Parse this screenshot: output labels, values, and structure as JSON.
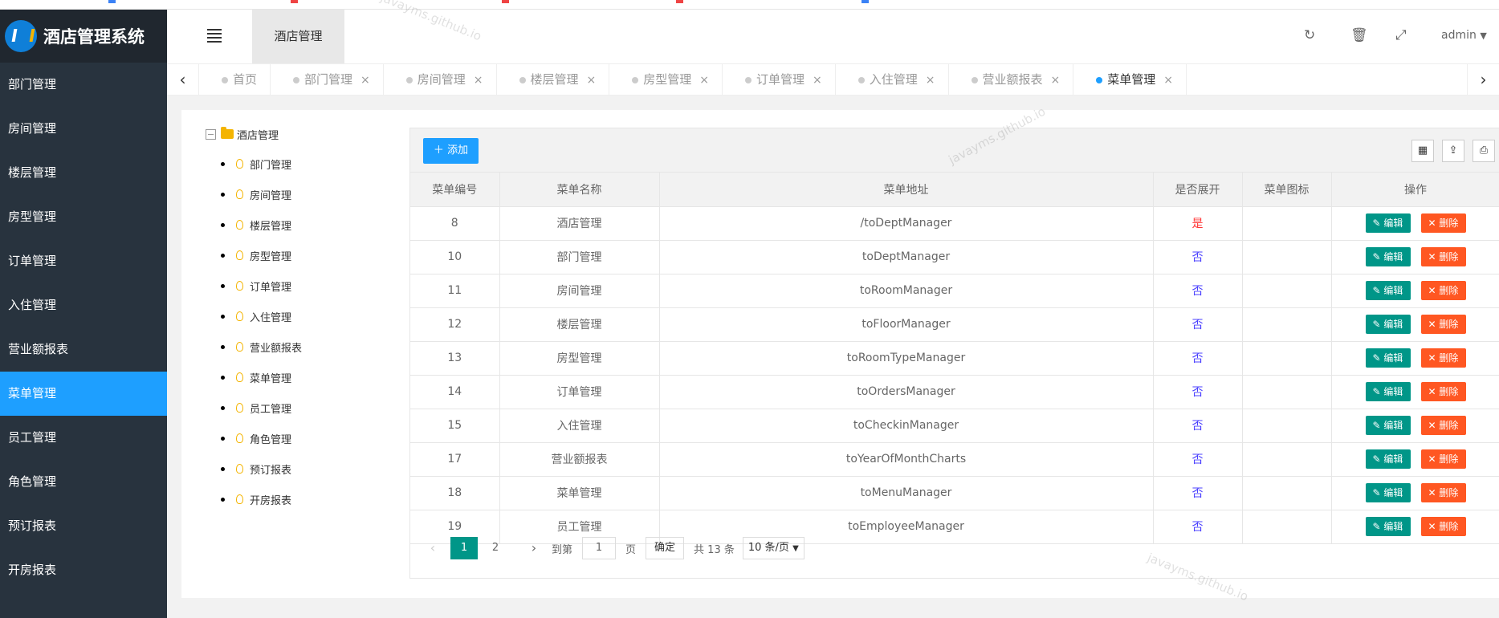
{
  "app": {
    "title": "酒店管理系统"
  },
  "header": {
    "current_tab": "酒店管理",
    "user": "admin"
  },
  "sidebar": {
    "items": [
      {
        "label": "部门管理",
        "active": false
      },
      {
        "label": "房间管理",
        "active": false
      },
      {
        "label": "楼层管理",
        "active": false
      },
      {
        "label": "房型管理",
        "active": false
      },
      {
        "label": "订单管理",
        "active": false
      },
      {
        "label": "入住管理",
        "active": false
      },
      {
        "label": "营业额报表",
        "active": false
      },
      {
        "label": "菜单管理",
        "active": true
      },
      {
        "label": "员工管理",
        "active": false
      },
      {
        "label": "角色管理",
        "active": false
      },
      {
        "label": "预订报表",
        "active": false
      },
      {
        "label": "开房报表",
        "active": false
      }
    ]
  },
  "tabs": [
    {
      "label": "首页",
      "closable": false
    },
    {
      "label": "部门管理",
      "closable": true
    },
    {
      "label": "房间管理",
      "closable": true
    },
    {
      "label": "楼层管理",
      "closable": true
    },
    {
      "label": "房型管理",
      "closable": true
    },
    {
      "label": "订单管理",
      "closable": true
    },
    {
      "label": "入住管理",
      "closable": true
    },
    {
      "label": "营业额报表",
      "closable": true
    },
    {
      "label": "菜单管理",
      "closable": true,
      "active": true
    }
  ],
  "tree": {
    "root": "酒店管理",
    "children": [
      "部门管理",
      "房间管理",
      "楼层管理",
      "房型管理",
      "订单管理",
      "入住管理",
      "营业额报表",
      "菜单管理",
      "员工管理",
      "角色管理",
      "预订报表",
      "开房报表"
    ]
  },
  "toolbar": {
    "add_label": "添加"
  },
  "table": {
    "headers": [
      "菜单编号",
      "菜单名称",
      "菜单地址",
      "是否展开",
      "菜单图标",
      "操作"
    ],
    "edit_label": "编辑",
    "delete_label": "删除",
    "rows": [
      {
        "id": "8",
        "name": "酒店管理",
        "url": "/toDeptManager",
        "expand": "是",
        "icon": ""
      },
      {
        "id": "10",
        "name": "部门管理",
        "url": "toDeptManager",
        "expand": "否",
        "icon": ""
      },
      {
        "id": "11",
        "name": "房间管理",
        "url": "toRoomManager",
        "expand": "否",
        "icon": ""
      },
      {
        "id": "12",
        "name": "楼层管理",
        "url": "toFloorManager",
        "expand": "否",
        "icon": ""
      },
      {
        "id": "13",
        "name": "房型管理",
        "url": "toRoomTypeManager",
        "expand": "否",
        "icon": ""
      },
      {
        "id": "14",
        "name": "订单管理",
        "url": "toOrdersManager",
        "expand": "否",
        "icon": ""
      },
      {
        "id": "15",
        "name": "入住管理",
        "url": "toCheckinManager",
        "expand": "否",
        "icon": ""
      },
      {
        "id": "17",
        "name": "营业额报表",
        "url": "toYearOfMonthCharts",
        "expand": "否",
        "icon": ""
      },
      {
        "id": "18",
        "name": "菜单管理",
        "url": "toMenuManager",
        "expand": "否",
        "icon": ""
      },
      {
        "id": "19",
        "name": "员工管理",
        "url": "toEmployeeManager",
        "expand": "否",
        "icon": ""
      }
    ]
  },
  "pager": {
    "current": "1",
    "next_page": "2",
    "goto_label": "到第",
    "goto_value": "1",
    "page_unit": "页",
    "ok_label": "确定",
    "total": "共 13 条",
    "page_size": "10 条/页"
  },
  "watermark": "javayms.github.io"
}
